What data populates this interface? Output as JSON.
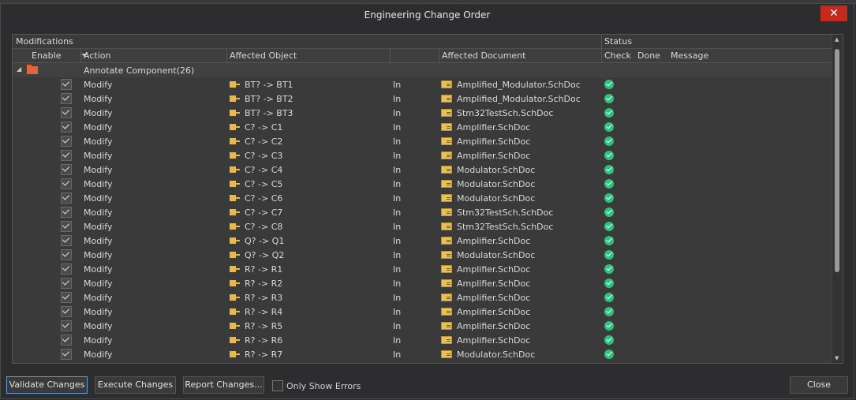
{
  "window": {
    "title": "Engineering Change Order",
    "close_glyph": "✕"
  },
  "groups": {
    "modifications": "Modifications",
    "status": "Status"
  },
  "columns": {
    "enable": "Enable",
    "action": "Action",
    "affected_object": "Affected Object",
    "affected_document": "Affected Document",
    "check": "Check",
    "done": "Done",
    "message": "Message"
  },
  "parent": {
    "label": "Annotate Component(26)",
    "expander": "◢"
  },
  "rows": [
    {
      "action": "Modify",
      "object": "BT? -> BT1",
      "dir": "In",
      "document": "Amplified_Modulator.SchDoc"
    },
    {
      "action": "Modify",
      "object": "BT? -> BT2",
      "dir": "In",
      "document": "Amplified_Modulator.SchDoc"
    },
    {
      "action": "Modify",
      "object": "BT? -> BT3",
      "dir": "In",
      "document": "Stm32TestSch.SchDoc"
    },
    {
      "action": "Modify",
      "object": "C? -> C1",
      "dir": "In",
      "document": "Amplifier.SchDoc"
    },
    {
      "action": "Modify",
      "object": "C? -> C2",
      "dir": "In",
      "document": "Amplifier.SchDoc"
    },
    {
      "action": "Modify",
      "object": "C? -> C3",
      "dir": "In",
      "document": "Amplifier.SchDoc"
    },
    {
      "action": "Modify",
      "object": "C? -> C4",
      "dir": "In",
      "document": "Modulator.SchDoc"
    },
    {
      "action": "Modify",
      "object": "C? -> C5",
      "dir": "In",
      "document": "Modulator.SchDoc"
    },
    {
      "action": "Modify",
      "object": "C? -> C6",
      "dir": "In",
      "document": "Modulator.SchDoc"
    },
    {
      "action": "Modify",
      "object": "C? -> C7",
      "dir": "In",
      "document": "Stm32TestSch.SchDoc"
    },
    {
      "action": "Modify",
      "object": "C? -> C8",
      "dir": "In",
      "document": "Stm32TestSch.SchDoc"
    },
    {
      "action": "Modify",
      "object": "Q? -> Q1",
      "dir": "In",
      "document": "Amplifier.SchDoc"
    },
    {
      "action": "Modify",
      "object": "Q? -> Q2",
      "dir": "In",
      "document": "Modulator.SchDoc"
    },
    {
      "action": "Modify",
      "object": "R? -> R1",
      "dir": "In",
      "document": "Amplifier.SchDoc"
    },
    {
      "action": "Modify",
      "object": "R? -> R2",
      "dir": "In",
      "document": "Amplifier.SchDoc"
    },
    {
      "action": "Modify",
      "object": "R? -> R3",
      "dir": "In",
      "document": "Amplifier.SchDoc"
    },
    {
      "action": "Modify",
      "object": "R? -> R4",
      "dir": "In",
      "document": "Amplifier.SchDoc"
    },
    {
      "action": "Modify",
      "object": "R? -> R5",
      "dir": "In",
      "document": "Amplifier.SchDoc"
    },
    {
      "action": "Modify",
      "object": "R? -> R6",
      "dir": "In",
      "document": "Amplifier.SchDoc"
    },
    {
      "action": "Modify",
      "object": "R? -> R7",
      "dir": "In",
      "document": "Modulator.SchDoc"
    }
  ],
  "buttons": {
    "validate": "Validate Changes",
    "execute": "Execute Changes",
    "report": "Report Changes...",
    "close": "Close"
  },
  "only_show_errors": {
    "label": "Only Show Errors",
    "checked": false
  },
  "colors": {
    "check_ok": "#2ec37a",
    "close_button": "#c42b1c",
    "component_icon": "#e8b84a",
    "folder_icon": "#e0653a"
  },
  "icons": {
    "component": "component-icon",
    "document": "schdoc-icon",
    "status": "check-ok-icon",
    "folder": "folder-icon"
  }
}
